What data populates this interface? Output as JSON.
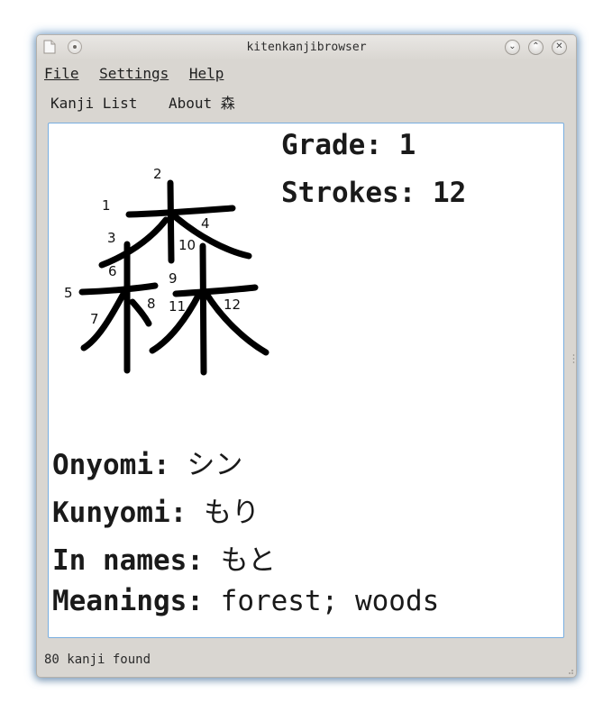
{
  "window": {
    "title": "kitenkanjibrowser"
  },
  "menu": [
    {
      "label": "File"
    },
    {
      "label": "Settings"
    },
    {
      "label": "Help"
    }
  ],
  "tabs": [
    {
      "label": "Kanji List"
    },
    {
      "label": "About 森"
    }
  ],
  "kanji": {
    "character": "森",
    "grade_text": "Grade: 1",
    "strokes_text": "Strokes: 12",
    "stroke_numbers": [
      "1",
      "2",
      "3",
      "4",
      "5",
      "6",
      "7",
      "8",
      "9",
      "10",
      "11",
      "12"
    ],
    "readings": {
      "onyomi": {
        "label": "Onyomi:",
        "value": "シン"
      },
      "kunyomi": {
        "label": "Kunyomi:",
        "value": "もり"
      },
      "in_names": {
        "label": "In names:",
        "value": "もと"
      },
      "meanings": {
        "label": "Meanings:",
        "value": "forest; woods"
      }
    }
  },
  "status": {
    "text": "80 kanji found"
  },
  "icons": {
    "app": "document-icon",
    "pin": "pin-icon",
    "minimize": "chevron-down-icon",
    "maximize": "chevron-up-icon",
    "close": "close-icon"
  }
}
